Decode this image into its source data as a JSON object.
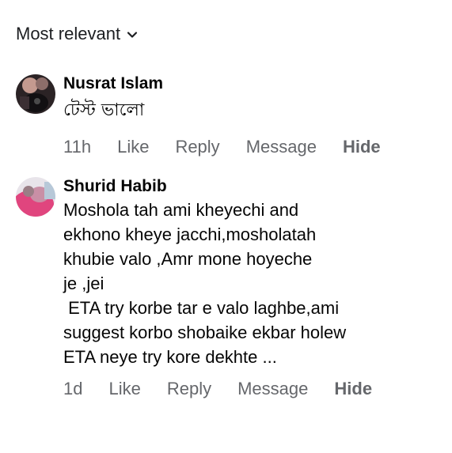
{
  "sort": {
    "label": "Most relevant"
  },
  "comments": [
    {
      "author": "Nusrat Islam",
      "text": "টেস্ট ভালো",
      "time": "11h",
      "actions": {
        "like": "Like",
        "reply": "Reply",
        "message": "Message",
        "hide": "Hide"
      }
    },
    {
      "author": "Shurid Habib",
      "text": "Moshola tah ami kheyechi and\nekhono kheye jacchi,mosholatah\nkhubie valo ,Amr mone hoyeche\nje ,jei\n ETA try korbe tar e valo laghbe,ami\nsuggest korbo shobaike ekbar holew\nETA neye try kore dekhte ...",
      "time": "1d",
      "actions": {
        "like": "Like",
        "reply": "Reply",
        "message": "Message",
        "hide": "Hide"
      }
    }
  ]
}
